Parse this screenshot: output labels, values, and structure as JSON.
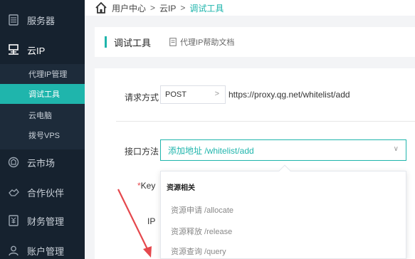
{
  "sidebar": {
    "items": [
      {
        "label": "服务器",
        "icon": "server-icon"
      },
      {
        "label": "云IP",
        "icon": "cloud-ip-icon"
      },
      {
        "label": "云市场",
        "icon": "market-icon"
      },
      {
        "label": "合作伙伴",
        "icon": "partner-icon"
      },
      {
        "label": "财务管理",
        "icon": "finance-icon"
      },
      {
        "label": "账户管理",
        "icon": "account-icon"
      }
    ],
    "submenu": [
      {
        "label": "代理IP管理",
        "active": false
      },
      {
        "label": "调试工具",
        "active": true
      },
      {
        "label": "云电脑",
        "active": false
      },
      {
        "label": "拨号VPS",
        "active": false
      }
    ]
  },
  "breadcrumb": {
    "home": "用户中心",
    "sep1": ">",
    "section": "云IP",
    "sep2": ">",
    "current": "调试工具"
  },
  "tab": {
    "title": "调试工具",
    "doc_link": "代理IP帮助文档"
  },
  "form": {
    "method_label": "请求方式",
    "method_value": "POST",
    "method_chevron": ">",
    "url": "https://proxy.qg.net/whitelist/add",
    "path_label": "接口方法",
    "path_value": "添加地址 /whitelist/add",
    "path_chevron": "∨",
    "key_required": "*",
    "key_label": "Key",
    "ip_label": "IP"
  },
  "dropdown": {
    "group": "资源相关",
    "options": [
      "资源申请 /allocate",
      "资源释放 /release",
      "资源查询 /query"
    ]
  },
  "colors": {
    "sidebar_bg": "#16222f",
    "accent": "#1fb5ac",
    "required": "#e5484d",
    "annotation_arrow": "#e5484d"
  }
}
